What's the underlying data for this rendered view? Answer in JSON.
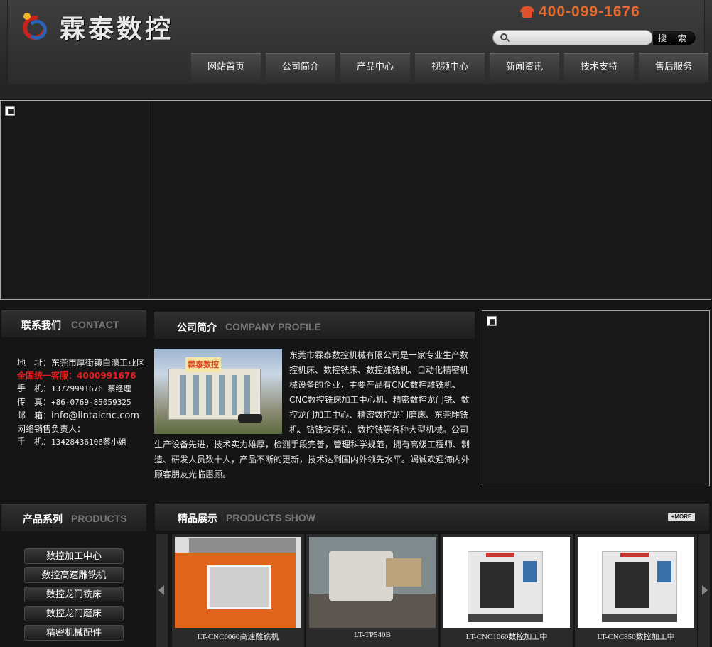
{
  "header": {
    "logo_text": "霖泰数控",
    "hotline": "400-099-1676",
    "search": {
      "placeholder": "",
      "button_label": "搜 索"
    }
  },
  "nav": {
    "items": [
      {
        "label": "网站首页"
      },
      {
        "label": "公司简介"
      },
      {
        "label": "产品中心"
      },
      {
        "label": "视频中心"
      },
      {
        "label": "新闻资讯"
      },
      {
        "label": "技术支持"
      },
      {
        "label": "售后服务"
      }
    ]
  },
  "contact": {
    "title_cn": "联系我们",
    "title_en": "CONTACT",
    "address": "地　址：东莞市厚街镇白濠工业区",
    "hotline": "全国统一客服：4000991676",
    "mobile_label": "手　机：",
    "mobile": "13729991676 蔡经理",
    "fax_label": "传　真：",
    "fax": "+86-0769-85059325",
    "email_label": "邮　箱：",
    "email": "info@lintaicnc.com",
    "sales_contact": "网络销售负责人：",
    "sales_mobile_label": "手　机：",
    "sales_mobile": "13428436106蔡小姐"
  },
  "profile": {
    "title_cn": "公司简介",
    "title_en": "COMPANY PROFILE",
    "image_sign": "霖泰数控",
    "text": "东莞市霖泰数控机械有限公司是一家专业生产数控机床、数控铣床、数控雕铣机、自动化精密机械设备的企业，主要产品有CNC数控雕铣机、CNC数控铣床加工中心机、精密数控龙门铣、数控龙门加工中心、精密数控龙门磨床、东莞雕铣机、钻铣攻牙机、数控铣等各种大型机械。公司生产设备先进，技术实力雄厚，检测手段完善，管理科学规范，拥有高级工程师、制造、研发人员数十人，产品不断的更新，技术达到国内外领先水平。竭诚欢迎海内外顾客朋友光临惠顾。"
  },
  "products": {
    "title_cn": "产品系列",
    "title_en": "PRODUCTS",
    "categories": [
      {
        "label": "数控加工中心"
      },
      {
        "label": "数控高速雕铣机"
      },
      {
        "label": "数控龙门铣床"
      },
      {
        "label": "数控龙门磨床"
      },
      {
        "label": "精密机械配件"
      }
    ]
  },
  "showcase": {
    "title_cn": "精品展示",
    "title_en": "PRODUCTS SHOW",
    "more_label": "+MORE",
    "items": [
      {
        "caption": "LT-CNC6060高速雕铣机"
      },
      {
        "caption": "LT-TP540B"
      },
      {
        "caption": "LT-CNC1060数控加工中"
      },
      {
        "caption": "LT-CNC850数控加工中"
      }
    ]
  }
}
